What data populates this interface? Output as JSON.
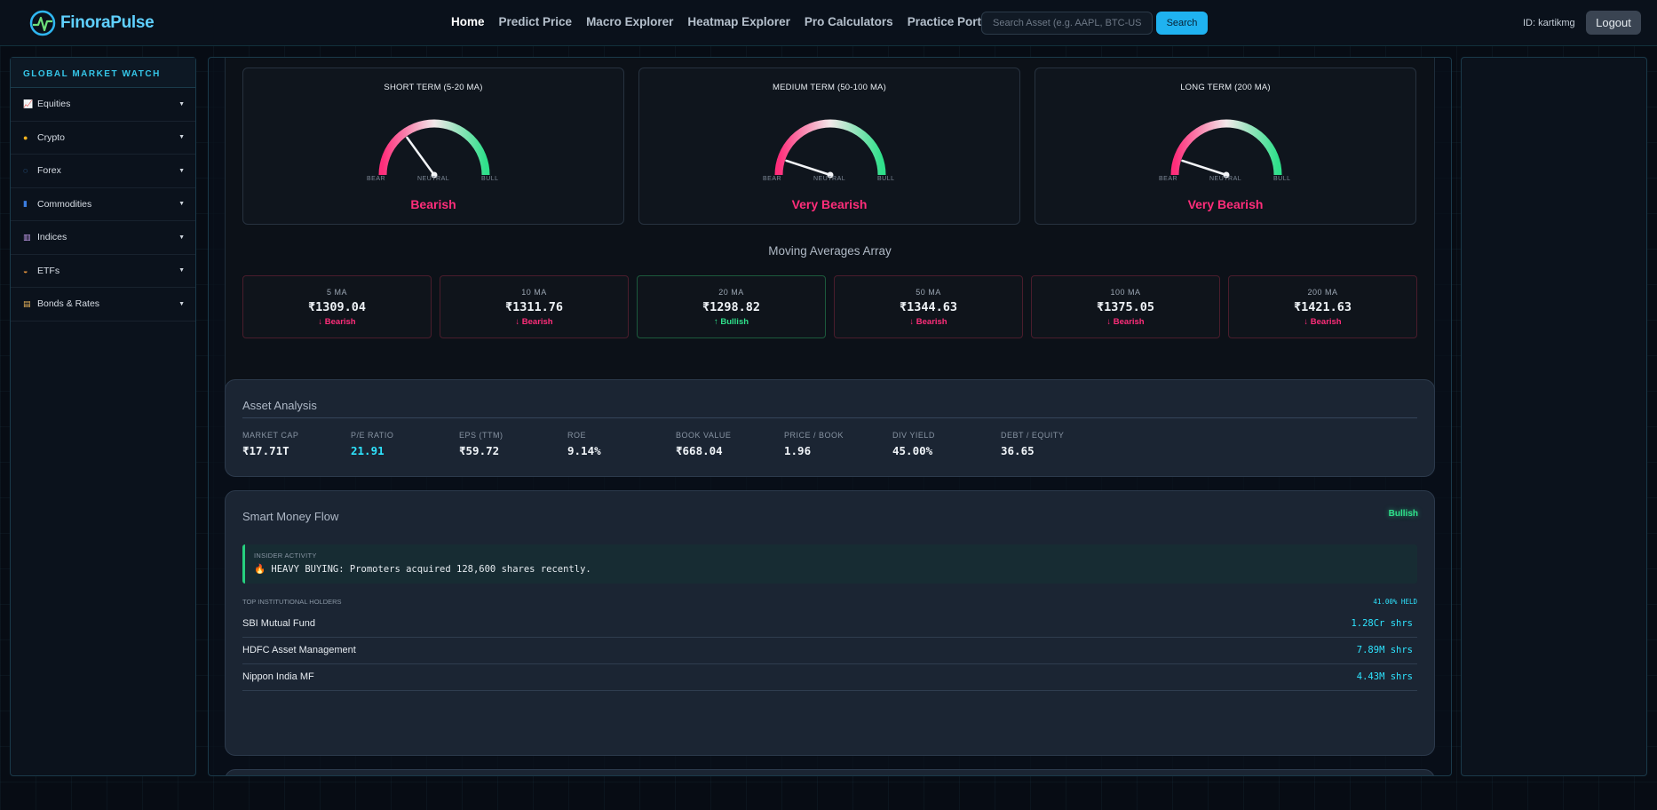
{
  "app": {
    "brand": "FinoraPulse",
    "nav": [
      "Home",
      "Predict Price",
      "Macro Explorer",
      "Heatmap Explorer",
      "Pro Calculators",
      "Practice Portfolio"
    ],
    "search": {
      "placeholder": "Search Asset (e.g. AAPL, BTC-USD)",
      "button": "Search"
    },
    "user_id": "ID: kartikmg",
    "logout": "Logout"
  },
  "sidebar": {
    "title": "GLOBAL MARKET WATCH",
    "items": [
      {
        "label": "Equities",
        "icon": "chart-icon"
      },
      {
        "label": "Crypto",
        "icon": "coin-icon"
      },
      {
        "label": "Forex",
        "icon": "exchange-icon"
      },
      {
        "label": "Commodities",
        "icon": "barrel-icon"
      },
      {
        "label": "Indices",
        "icon": "bar-chart-icon"
      },
      {
        "label": "ETFs",
        "icon": "basket-icon"
      },
      {
        "label": "Bonds & Rates",
        "icon": "scroll-icon"
      }
    ]
  },
  "gauges": [
    {
      "title": "SHORT TERM (5-20 MA)",
      "status": "Bearish",
      "level": 0.3,
      "labels": [
        "BEAR",
        "NEUTRAL",
        "BULL"
      ]
    },
    {
      "title": "MEDIUM TERM (50-100 MA)",
      "status": "Very Bearish",
      "level": 0.1,
      "labels": [
        "BEAR",
        "NEUTRAL",
        "BULL"
      ]
    },
    {
      "title": "LONG TERM (200 MA)",
      "status": "Very Bearish",
      "level": 0.1,
      "labels": [
        "BEAR",
        "NEUTRAL",
        "BULL"
      ]
    }
  ],
  "moving_averages": {
    "title": "Moving Averages Array",
    "items": [
      {
        "label": "5 MA",
        "value": "₹1309.04",
        "signal": "↓ Bearish",
        "bullish": false
      },
      {
        "label": "10 MA",
        "value": "₹1311.76",
        "signal": "↓ Bearish",
        "bullish": false
      },
      {
        "label": "20 MA",
        "value": "₹1298.82",
        "signal": "↑ Bullish",
        "bullish": true
      },
      {
        "label": "50 MA",
        "value": "₹1344.63",
        "signal": "↓ Bearish",
        "bullish": false
      },
      {
        "label": "100 MA",
        "value": "₹1375.05",
        "signal": "↓ Bearish",
        "bullish": false
      },
      {
        "label": "200 MA",
        "value": "₹1421.63",
        "signal": "↓ Bearish",
        "bullish": false
      }
    ]
  },
  "asset_analysis": {
    "title": "Asset Analysis",
    "metrics": [
      {
        "label": "MARKET CAP",
        "value": "₹17.71T",
        "accent": false
      },
      {
        "label": "P/E RATIO",
        "value": "21.91",
        "accent": true
      },
      {
        "label": "EPS (TTM)",
        "value": "₹59.72",
        "accent": false
      },
      {
        "label": "ROE",
        "value": "9.14%",
        "accent": false
      },
      {
        "label": "BOOK VALUE",
        "value": "₹668.04",
        "accent": false
      },
      {
        "label": "PRICE / BOOK",
        "value": "1.96",
        "accent": false
      },
      {
        "label": "DIV YIELD",
        "value": "45.00%",
        "accent": false
      },
      {
        "label": "DEBT / EQUITY",
        "value": "36.65",
        "accent": false
      }
    ]
  },
  "smart_money": {
    "title": "Smart Money Flow",
    "badge": "Bullish",
    "insider_label": "INSIDER ACTIVITY",
    "insider_text": "🔥 HEAVY BUYING: Promoters acquired 128,600 shares recently.",
    "holders_label": "TOP INSTITUTIONAL HOLDERS",
    "held_pct": "41.00% HELD",
    "holders": [
      {
        "name": "SBI Mutual Fund",
        "shares": "1.28Cr shrs"
      },
      {
        "name": "HDFC Asset Management",
        "shares": "7.89M shrs"
      },
      {
        "name": "Nippon India MF",
        "shares": "4.43M shrs"
      }
    ]
  },
  "colors": {
    "bear": "#ff2d7a",
    "bull": "#2fe08b",
    "accent": "#2ee4ff"
  }
}
